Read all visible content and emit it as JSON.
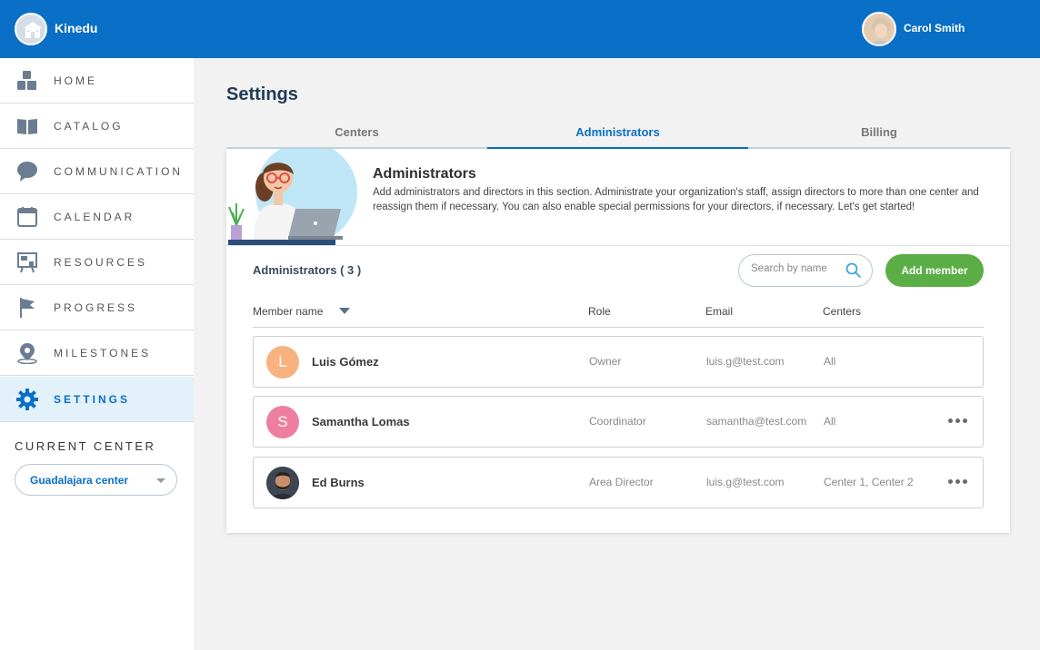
{
  "app": {
    "name": "Kinedu",
    "logo_icon": "school-building-icon"
  },
  "user": {
    "name": "Carol Smith"
  },
  "sidebar": {
    "items": [
      {
        "label": "HOME",
        "icon": "blocks-icon"
      },
      {
        "label": "CATALOG",
        "icon": "book-icon"
      },
      {
        "label": "COMMUNICATION",
        "icon": "chat-bubble-icon"
      },
      {
        "label": "CALENDAR",
        "icon": "calendar-icon"
      },
      {
        "label": "RESOURCES",
        "icon": "whiteboard-icon"
      },
      {
        "label": "PROGRESS",
        "icon": "flag-icon"
      },
      {
        "label": "MILESTONES",
        "icon": "map-pin-icon"
      },
      {
        "label": "SETTINGS",
        "icon": "gear-icon",
        "active": true
      }
    ],
    "current_center_label": "CURRENT CENTER",
    "current_center_value": "Guadalajara center"
  },
  "page": {
    "title": "Settings",
    "tabs": [
      {
        "label": "Centers",
        "active": false
      },
      {
        "label": "Administrators",
        "active": true
      },
      {
        "label": "Billing",
        "active": false
      }
    ]
  },
  "banner": {
    "title": "Administrators",
    "description": "Add administrators and directors in this section. Administrate your organization's staff, assign directors to more than one center and reassign them if necessary. You can also enable special permissions for your directors, if necessary. Let's get started!"
  },
  "admins": {
    "count_label": "Administrators ( 3 )",
    "search_placeholder": "Search by name",
    "add_button": "Add member",
    "columns": [
      "Member name",
      "Role",
      "Email",
      "Centers"
    ],
    "rows": [
      {
        "initial": "L",
        "avatar_color": "#f7b27f",
        "name": "Luis Gómez",
        "role": "Owner",
        "email": "luis.g@test.com",
        "centers": "All",
        "has_menu": false
      },
      {
        "initial": "S",
        "avatar_color": "#ee7ea0",
        "name": "Samantha Lomas",
        "role": "Coordinator",
        "email": "samantha@test.com",
        "centers": "All",
        "has_menu": true
      },
      {
        "initial": "",
        "avatar_color": "#4a5563",
        "name": "Ed Burns",
        "role": "Area Director",
        "email": "luis.g@test.com",
        "centers": "Center 1, Center 2",
        "has_menu": true
      }
    ]
  },
  "colors": {
    "brand": "#0a6fc7",
    "add_button": "#5bae45",
    "active_nav_bg": "#e3f1fb"
  }
}
